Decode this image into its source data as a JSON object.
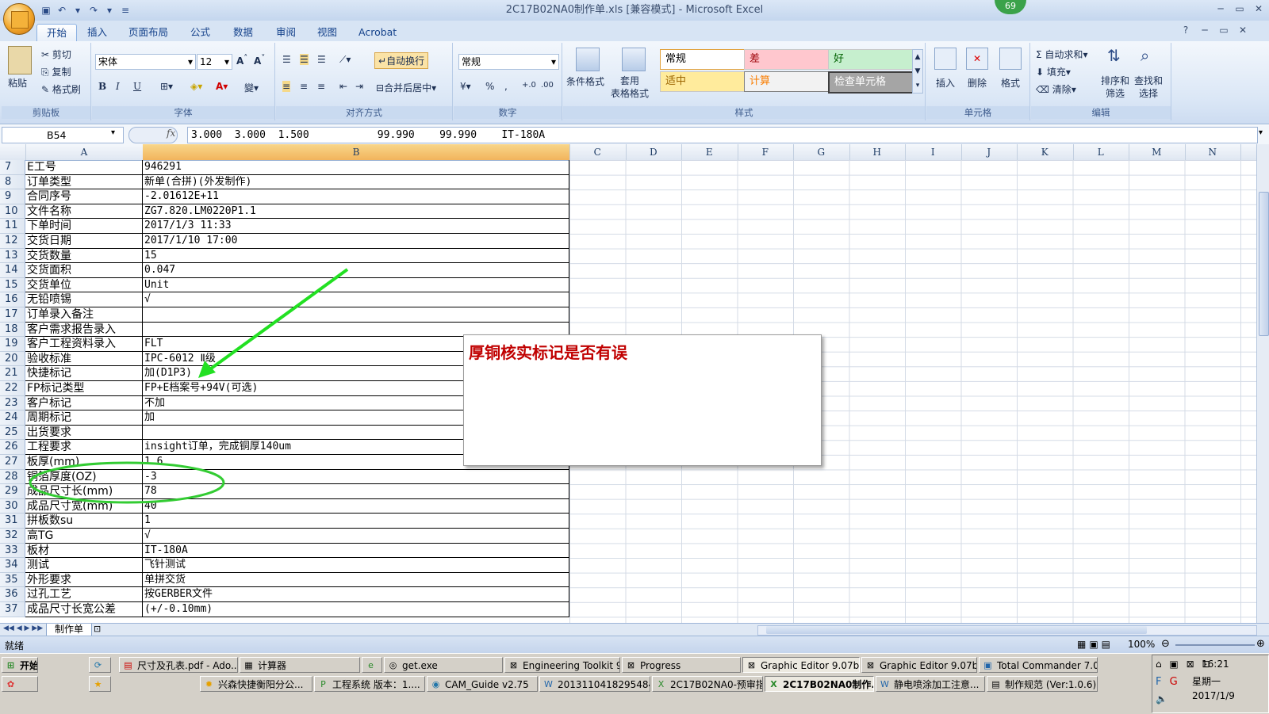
{
  "app": {
    "title": "2C17B02NA0制作单.xls  [兼容模式] - Microsoft Excel",
    "badge": "69"
  },
  "ribbon": {
    "tabs": [
      "开始",
      "插入",
      "页面布局",
      "公式",
      "数据",
      "审阅",
      "视图",
      "Acrobat"
    ],
    "clipboard": {
      "paste": "粘贴",
      "cut": "剪切",
      "copy": "复制",
      "format_painter": "格式刷",
      "label": "剪贴板"
    },
    "font": {
      "name": "宋体",
      "size": "12",
      "bold": "B",
      "italic": "I",
      "underline": "U",
      "label": "字体"
    },
    "alignment": {
      "wrap": "自动换行",
      "merge": "合并后居中",
      "label": "对齐方式"
    },
    "number": {
      "format": "常规",
      "percent": "%",
      "comma": ",",
      "label": "数字"
    },
    "styles": {
      "conditional": "条件格式",
      "table": "套用\n表格格式",
      "cells": [
        "常规",
        "差",
        "好",
        "适中",
        "计算",
        "检查单元格"
      ],
      "label": "样式"
    },
    "cells_group": {
      "insert": "插入",
      "delete": "删除",
      "format": "格式",
      "label": "单元格"
    },
    "editing": {
      "autosum": "自动求和",
      "fill": "填充",
      "clear": "清除",
      "sort": "排序和\n筛选",
      "find": "查找和\n选择",
      "label": "编辑"
    }
  },
  "formula_bar": {
    "name_box": "B54",
    "fx": "fx",
    "value": "3.000  3.000  1.500           99.990    99.990    IT-180A"
  },
  "columns": [
    "A",
    "B",
    "C",
    "D",
    "E",
    "F",
    "G",
    "H",
    "I",
    "J",
    "K",
    "L",
    "M",
    "N"
  ],
  "rows": [
    {
      "n": "7",
      "a": "E工号",
      "b": "946291"
    },
    {
      "n": "8",
      "a": "订单类型",
      "b": "新单(合拼)(外发制作)"
    },
    {
      "n": "9",
      "a": "合同序号",
      "b": "-2.01612E+11"
    },
    {
      "n": "10",
      "a": "文件名称",
      "b": "ZG7.820.LM0220P1.1"
    },
    {
      "n": "11",
      "a": "下单时间",
      "b": "2017/1/3 11:33"
    },
    {
      "n": "12",
      "a": "交货日期",
      "b": "2017/1/10 17:00"
    },
    {
      "n": "13",
      "a": "交货数量",
      "b": "15"
    },
    {
      "n": "14",
      "a": "交货面积",
      "b": "0.047"
    },
    {
      "n": "15",
      "a": "交货单位",
      "b": "Unit"
    },
    {
      "n": "16",
      "a": "无铅喷锡",
      "b": "√"
    },
    {
      "n": "17",
      "a": "订单录入备注",
      "b": ""
    },
    {
      "n": "18",
      "a": "客户需求报告录入",
      "b": ""
    },
    {
      "n": "19",
      "a": "客户工程资料录入",
      "b": "FLT"
    },
    {
      "n": "20",
      "a": "验收标准",
      "b": "IPC-6012 Ⅱ级"
    },
    {
      "n": "21",
      "a": "快捷标记",
      "b": "加(D1P3)"
    },
    {
      "n": "22",
      "a": "FP标记类型",
      "b": "FP+E档案号+94V(可选)"
    },
    {
      "n": "23",
      "a": "客户标记",
      "b": "不加"
    },
    {
      "n": "24",
      "a": "周期标记",
      "b": "加"
    },
    {
      "n": "25",
      "a": "出货要求",
      "b": ""
    },
    {
      "n": "26",
      "a": "工程要求",
      "b": "insight订单，完成铜厚140um"
    },
    {
      "n": "27",
      "a": "板厚(mm)",
      "b": "1.6"
    },
    {
      "n": "28",
      "a": "铜箔厚度(OZ)",
      "b": "-3"
    },
    {
      "n": "29",
      "a": "成品尺寸长(mm)",
      "b": "78"
    },
    {
      "n": "30",
      "a": "成品尺寸宽(mm)",
      "b": "40"
    },
    {
      "n": "31",
      "a": "拼板数su",
      "b": "1"
    },
    {
      "n": "32",
      "a": "高TG",
      "b": "√"
    },
    {
      "n": "33",
      "a": "板材",
      "b": "IT-180A"
    },
    {
      "n": "34",
      "a": "测试",
      "b": "飞针测试"
    },
    {
      "n": "35",
      "a": "外形要求",
      "b": "单拼交货"
    },
    {
      "n": "36",
      "a": "过孔工艺",
      "b": "按GERBER文件"
    },
    {
      "n": "37",
      "a": "成品尺寸长宽公差",
      "b": "(+/-0.10mm)"
    }
  ],
  "callout": "厚铜核实标记是否有误",
  "sheet_tab": "制作单",
  "status": {
    "ready": "就绪",
    "zoom": "100%"
  },
  "taskbar": {
    "start": "开始",
    "row1": [
      "尺寸及孔表.pdf - Ado...",
      "计算器",
      "get.exe",
      "Engineering Toolkit 9.0...",
      "Progress",
      "Graphic Editor 9.07b2 (...",
      "Graphic Editor 9.07b2 (...",
      "Total Commander 7.0 p..."
    ],
    "row2": [
      "兴森快捷衡阳分公...",
      "工程系统  版本：1....",
      "CAM_Guide v2.75",
      "20131104182954843...",
      "2C17B02NA0-预审指...",
      "2C17B02NA0制作...",
      "静电喷涂加工注意...",
      "制作规范 (Ver:1.0.6)"
    ],
    "time": "16:21",
    "weekday": "星期一",
    "date": "2017/1/9"
  },
  "colors": {
    "callout_text": "#c00000",
    "arrow": "#22e022",
    "ellipse": "#33cc33",
    "ribbon": "#dbe7f6"
  }
}
